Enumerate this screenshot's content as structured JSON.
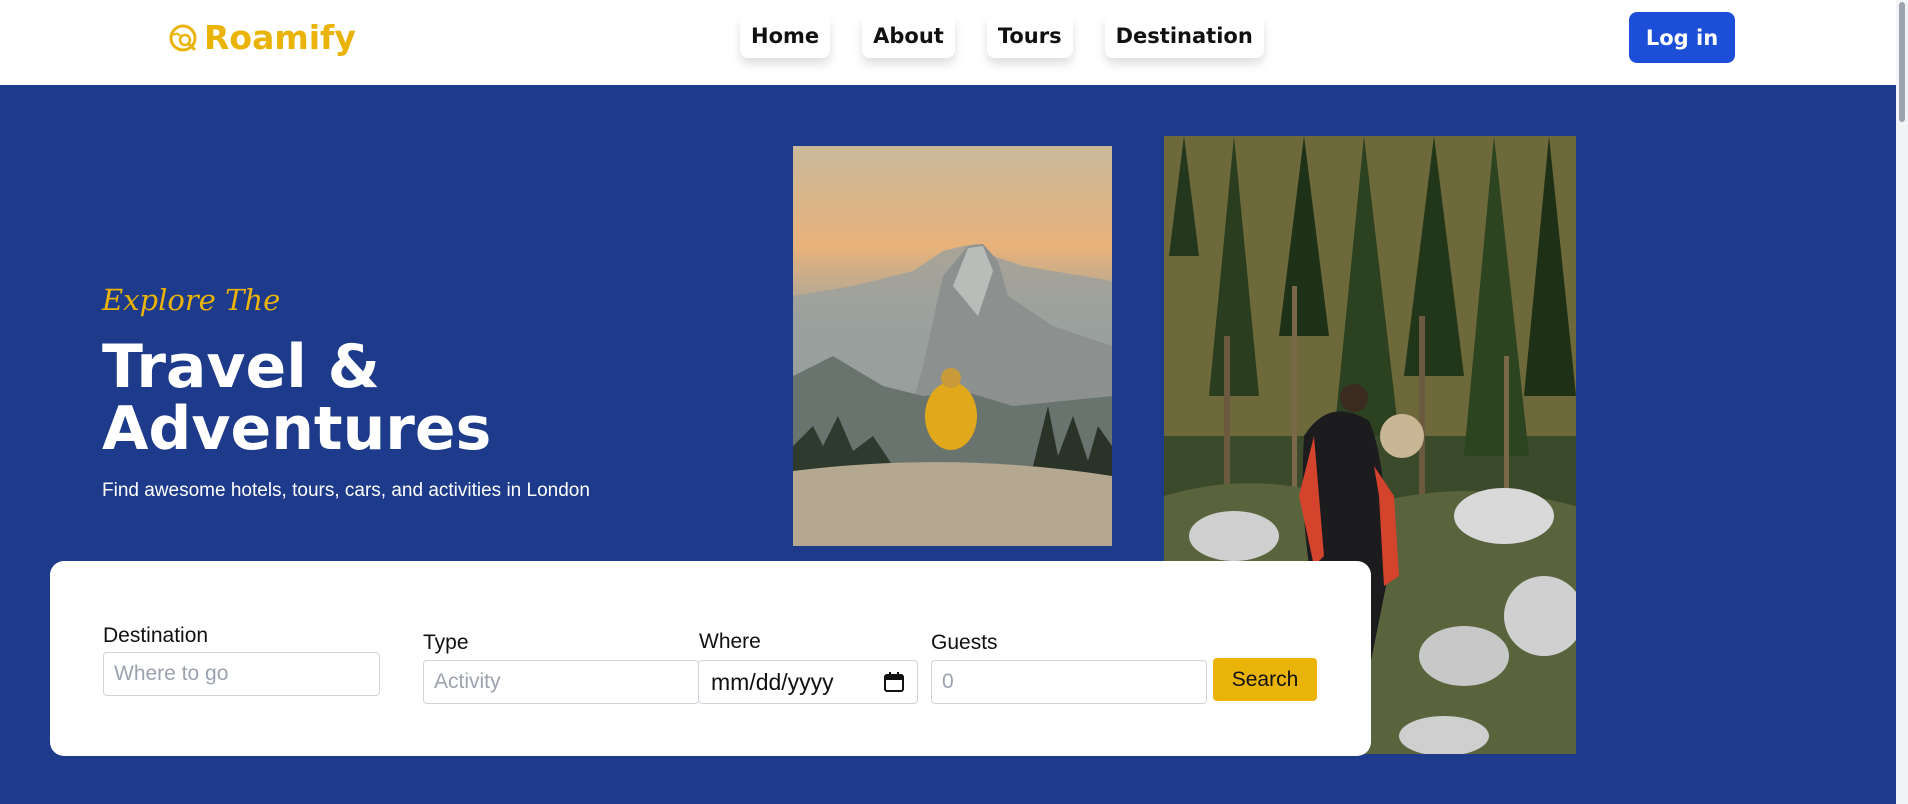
{
  "brand": {
    "name": "Roamify",
    "icon": "globe-search-icon",
    "color": "#eab308"
  },
  "nav": {
    "links": [
      {
        "label": "Home"
      },
      {
        "label": "About"
      },
      {
        "label": "Tours"
      },
      {
        "label": "Destination"
      }
    ],
    "login_label": "Log in"
  },
  "hero": {
    "eyebrow": "Explore The",
    "title_line1": "Travel &",
    "title_line2": "Adventures",
    "subtitle": "Find awesome hotels, tours, cars, and activities in London"
  },
  "search": {
    "destination": {
      "label": "Destination",
      "placeholder": "Where to go"
    },
    "type": {
      "label": "Type",
      "placeholder": "Activity"
    },
    "where": {
      "label": "Where",
      "value": "mm/dd/yyyy",
      "icon": "calendar-icon"
    },
    "guests": {
      "label": "Guests",
      "placeholder": "0"
    },
    "button_label": "Search"
  },
  "colors": {
    "hero_bg": "#1e3a8a",
    "accent": "#eab308",
    "login_bg": "#1d4ed8"
  }
}
